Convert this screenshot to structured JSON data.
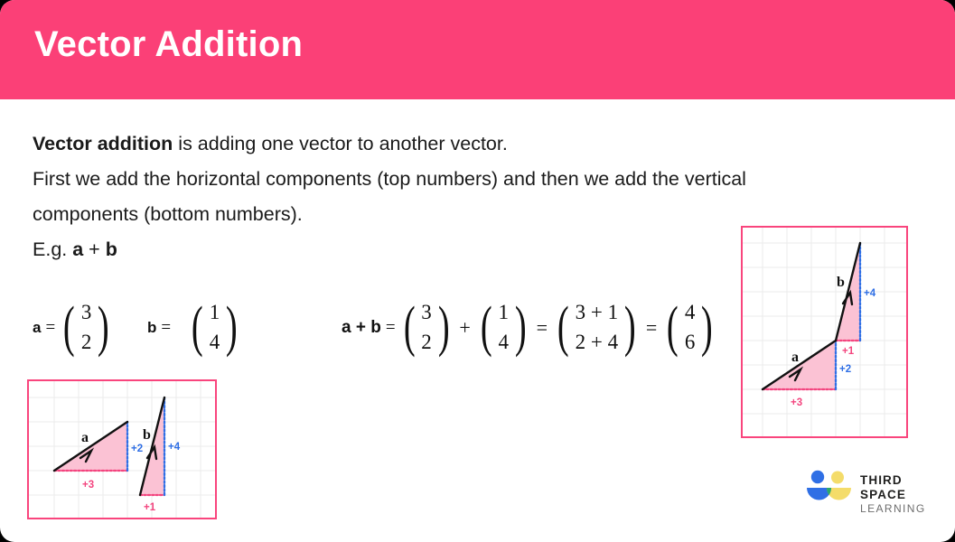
{
  "header": {
    "title": "Vector Addition",
    "background_color": "#fb4077",
    "text_color": "#ffffff"
  },
  "body": {
    "line1_bold": "Vector addition",
    "line1_rest": " is adding one vector to another vector.",
    "line2": "First we add the horizontal components (top numbers) and then we add the vertical",
    "line3": "components (bottom numbers).",
    "line4_prefix": "E.g. ",
    "line4_bold_a": "a",
    "line4_plus": " + ",
    "line4_bold_b": "b"
  },
  "vector_a": {
    "label": "a",
    "equals": "=",
    "top": "3",
    "bottom": "2"
  },
  "vector_b": {
    "label": "b",
    "equals": "=",
    "top": "1",
    "bottom": "4"
  },
  "sum_equation": {
    "label": "a + b",
    "equals1": "=",
    "term1_top": "3",
    "term1_bottom": "2",
    "plus": "+",
    "term2_top": "1",
    "term2_bottom": "4",
    "equals2": "=",
    "term3_top": "3 + 1",
    "term3_bottom": "2 + 4",
    "equals3": "=",
    "result_top": "4",
    "result_bottom": "6"
  },
  "diagram_left": {
    "caption_a": "a",
    "caption_b": "b",
    "a_horizontal": "+3",
    "a_vertical": "+2",
    "b_horizontal": "+1",
    "b_vertical": "+4",
    "border_color": "#f9457d",
    "fill_color": "#fbc2d4",
    "grid_color": "#ebebeb",
    "horizontal_label_color": "#f3457f",
    "vertical_label_color": "#2f6fe5"
  },
  "diagram_right": {
    "caption_a": "a",
    "caption_b": "b",
    "a_horizontal": "+3",
    "a_vertical": "+2",
    "b_horizontal": "+1",
    "b_vertical": "+4",
    "border_color": "#f9457d",
    "fill_color": "#fbc2d4",
    "grid_color": "#ebebeb",
    "horizontal_label_color": "#f3457f",
    "vertical_label_color": "#2f6fe5"
  },
  "logo": {
    "line1": "THIRD SPACE",
    "line2": "LEARNING",
    "blue": "#2f6fe5",
    "yellow": "#f4dc6a",
    "green": "#2aa86a"
  }
}
